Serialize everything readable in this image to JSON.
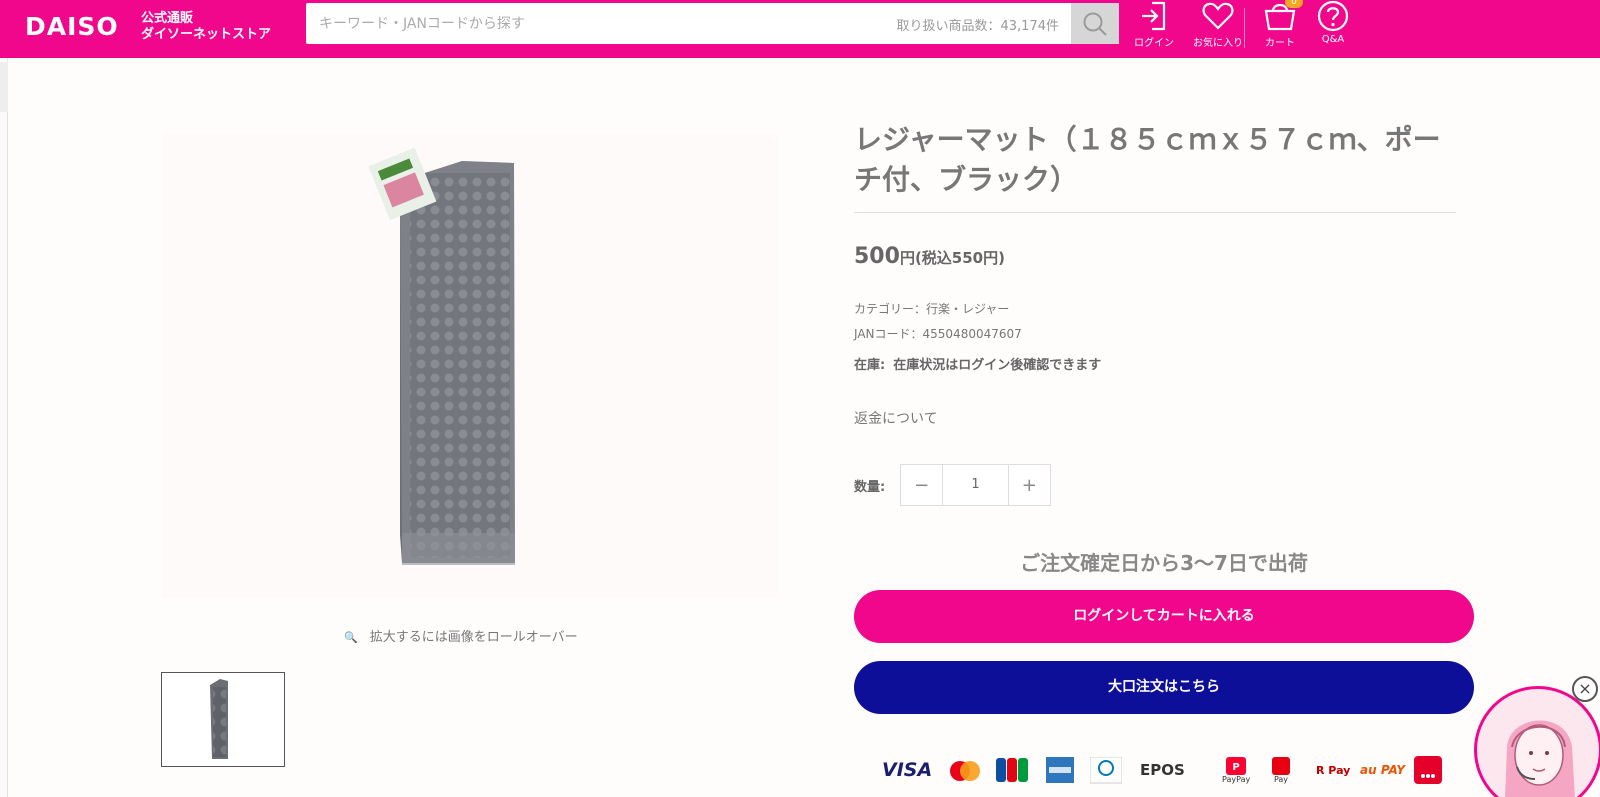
{
  "header": {
    "logo": "DAISO",
    "logo_sub_1": "公式通販",
    "logo_sub_2": "ダイソーネットストア",
    "search_placeholder": "キーワード・JANコードから探す",
    "item_count": "取り扱い商品数：43,174件",
    "nav": {
      "login": "ログイン",
      "favorites": "お気に入り",
      "cart": "カート",
      "cart_count": "0",
      "qa": "Q&A"
    }
  },
  "gallery": {
    "zoom_hint": "拡大するには画像をロールオーバー"
  },
  "product": {
    "title": "レジャーマット（１８５ｃｍｘ５７ｃｍ、ポーチ付、ブラック）",
    "price": "500",
    "price_unit": "円",
    "price_tax": "(税込550円)",
    "category": "カテゴリー：行楽・レジャー",
    "jan": "JANコード：4550480047607",
    "stock_label": "在庫:",
    "stock_value": "在庫状況はログイン後確認できます",
    "refund_link": "返金について",
    "quantity_label": "数量:",
    "quantity_value": "1",
    "shipping_note": "ご注文確定日から3〜7日で出荷",
    "cart_button": "ログインしてカートに入れる",
    "bulk_button": "大口注文はこちら"
  },
  "payments": {
    "visa": "VISA",
    "epos": "EPOS",
    "au": "au PAY",
    "paypay": "PayPay",
    "pay": "Pay",
    "rpay": "R Pay"
  },
  "colors": {
    "brand_pink": "#f0078b",
    "navy": "#0e0f99"
  }
}
